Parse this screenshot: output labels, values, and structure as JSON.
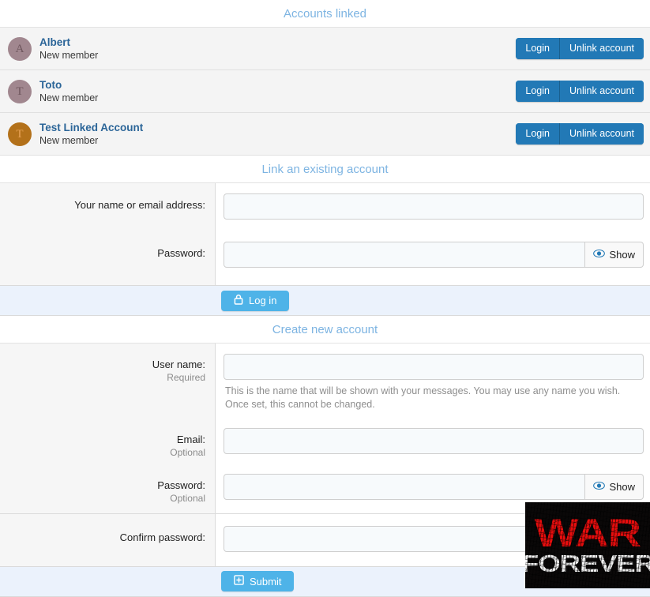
{
  "sections": {
    "accounts_linked_title": "Accounts linked",
    "link_existing_title": "Link an existing account",
    "create_new_title": "Create new account"
  },
  "accounts": [
    {
      "initial": "A",
      "name": "Albert",
      "status": "New member",
      "avatar_color": "#a1878f",
      "avatar_text_color": "#6e565d",
      "login_label": "Login",
      "unlink_label": "Unlink account"
    },
    {
      "initial": "T",
      "name": "Toto",
      "status": "New member",
      "avatar_color": "#a1878f",
      "avatar_text_color": "#6e565d",
      "login_label": "Login",
      "unlink_label": "Unlink account"
    },
    {
      "initial": "T",
      "name": "Test Linked Account",
      "status": "New member",
      "avatar_color": "#b3711a",
      "avatar_text_color": "#e9a257",
      "login_label": "Login",
      "unlink_label": "Unlink account"
    }
  ],
  "login_form": {
    "name_label": "Your name or email address:",
    "name_value": "",
    "password_label": "Password:",
    "password_value": "",
    "show_label": "Show",
    "submit_label": "Log in",
    "submit_icon": "lock-icon"
  },
  "register_form": {
    "username_label": "User name:",
    "username_note": "Required",
    "username_value": "",
    "username_help": "This is the name that will be shown with your messages. You may use any name you wish. Once set, this cannot be changed.",
    "email_label": "Email:",
    "email_note": "Optional",
    "email_value": "",
    "password_label": "Password:",
    "password_note": "Optional",
    "password_value": "",
    "show_label": "Show",
    "confirm_label": "Confirm password:",
    "confirm_value": "",
    "submit_label": "Submit",
    "submit_icon": "plus-square-icon"
  },
  "overlay": {
    "line1": "WAR",
    "line2": "FOREVER",
    "line1_color": "#e60d0d",
    "line2_color": "#f2f2f2",
    "background": "#0a0808"
  },
  "theme": {
    "section_title_color": "#7db4e2",
    "account_name_color": "#2b6598",
    "button_blue": "#2279b6",
    "primary_blue": "#4eb3e8",
    "row_background": "#f4f4f4",
    "action_bar_background": "#ebf2fc"
  }
}
